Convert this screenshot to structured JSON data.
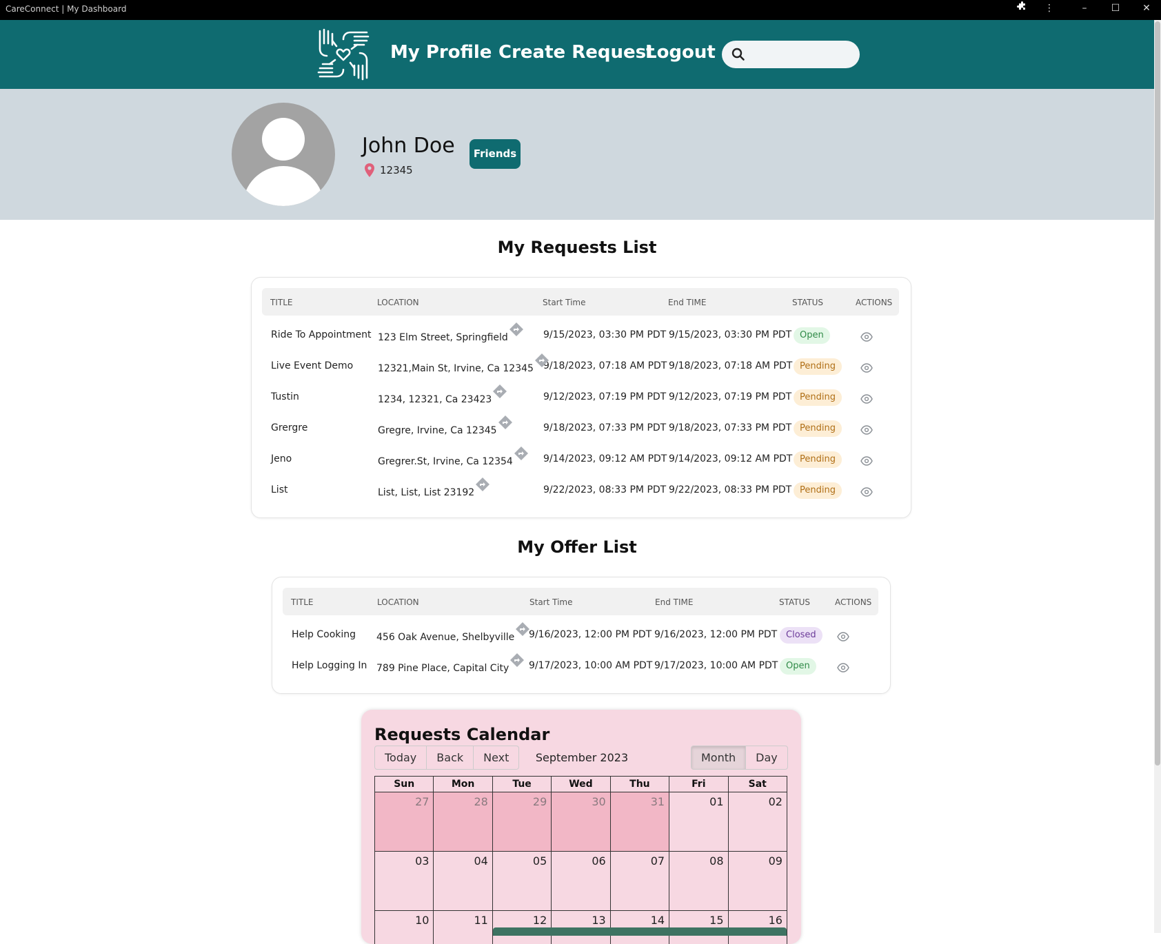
{
  "window": {
    "title": "CareConnect | My Dashboard"
  },
  "nav": {
    "links": [
      "My Profile",
      "Create Request",
      "Logout"
    ],
    "search_placeholder": "",
    "brand_color": "#0f6b70"
  },
  "profile": {
    "name": "John Doe",
    "zip": "12345",
    "friends_label": "Friends"
  },
  "requests": {
    "title": "My Requests List",
    "columns": [
      "TITLE",
      "LOCATION",
      "Start Time",
      "End TIME",
      "STATUS",
      "ACTIONS"
    ],
    "rows": [
      {
        "title": "Ride To Appointment",
        "location": "123 Elm Street, Springfield",
        "start": "9/15/2023, 03:30 PM PDT",
        "end": "9/15/2023, 03:30 PM PDT",
        "status": "Open"
      },
      {
        "title": "Live Event Demo",
        "location": "12321,Main St, Irvine, Ca 12345",
        "start": "9/18/2023, 07:18 AM PDT",
        "end": "9/18/2023, 07:18 AM PDT",
        "status": "Pending"
      },
      {
        "title": "Tustin",
        "location": "1234, 12321, Ca 23423",
        "start": "9/12/2023, 07:19 PM PDT",
        "end": "9/12/2023, 07:19 PM PDT",
        "status": "Pending"
      },
      {
        "title": "Grergre",
        "location": "Gregre, Irvine, Ca 12345",
        "start": "9/18/2023, 07:33 PM PDT",
        "end": "9/18/2023, 07:33 PM PDT",
        "status": "Pending"
      },
      {
        "title": "Jeno",
        "location": "Gregrer.St, Irvine, Ca 12354",
        "start": "9/14/2023, 09:12 AM PDT",
        "end": "9/14/2023, 09:12 AM PDT",
        "status": "Pending"
      },
      {
        "title": "List",
        "location": "List, List, List 23192",
        "start": "9/22/2023, 08:33 PM PDT",
        "end": "9/22/2023, 08:33 PM PDT",
        "status": "Pending"
      }
    ]
  },
  "offers": {
    "title": "My Offer List",
    "columns": [
      "TITLE",
      "LOCATION",
      "Start Time",
      "End TIME",
      "STATUS",
      "ACTIONS"
    ],
    "rows": [
      {
        "title": "Help Cooking",
        "location": "456 Oak Avenue, Shelbyville",
        "start": "9/16/2023, 12:00 PM PDT",
        "end": "9/16/2023, 12:00 PM PDT",
        "status": "Closed"
      },
      {
        "title": "Help Logging In",
        "location": "789 Pine Place, Capital City",
        "start": "9/17/2023, 10:00 AM PDT",
        "end": "9/17/2023, 10:00 AM PDT",
        "status": "Open"
      }
    ]
  },
  "calendar": {
    "title": "Requests Calendar",
    "nav_buttons": [
      "Today",
      "Back",
      "Next"
    ],
    "view_buttons": [
      "Month",
      "Day"
    ],
    "active_view": "Month",
    "label": "September 2023",
    "weekdays": [
      "Sun",
      "Mon",
      "Tue",
      "Wed",
      "Thu",
      "Fri",
      "Sat"
    ],
    "weeks": [
      [
        {
          "d": "27",
          "off": true
        },
        {
          "d": "28",
          "off": true
        },
        {
          "d": "29",
          "off": true
        },
        {
          "d": "30",
          "off": true
        },
        {
          "d": "31",
          "off": true
        },
        {
          "d": "01",
          "off": false
        },
        {
          "d": "02",
          "off": false
        }
      ],
      [
        {
          "d": "03",
          "off": false
        },
        {
          "d": "04",
          "off": false
        },
        {
          "d": "05",
          "off": false
        },
        {
          "d": "06",
          "off": false
        },
        {
          "d": "07",
          "off": false
        },
        {
          "d": "08",
          "off": false
        },
        {
          "d": "09",
          "off": false
        }
      ],
      [
        {
          "d": "10",
          "off": false
        },
        {
          "d": "11",
          "off": false
        },
        {
          "d": "12",
          "off": false
        },
        {
          "d": "13",
          "off": false
        },
        {
          "d": "14",
          "off": false
        },
        {
          "d": "15",
          "off": false
        },
        {
          "d": "16",
          "off": false
        }
      ]
    ]
  },
  "icons": {
    "direction": "direction-sign-icon",
    "view": "eye-icon",
    "location": "map-pin-icon",
    "search": "search-icon"
  }
}
